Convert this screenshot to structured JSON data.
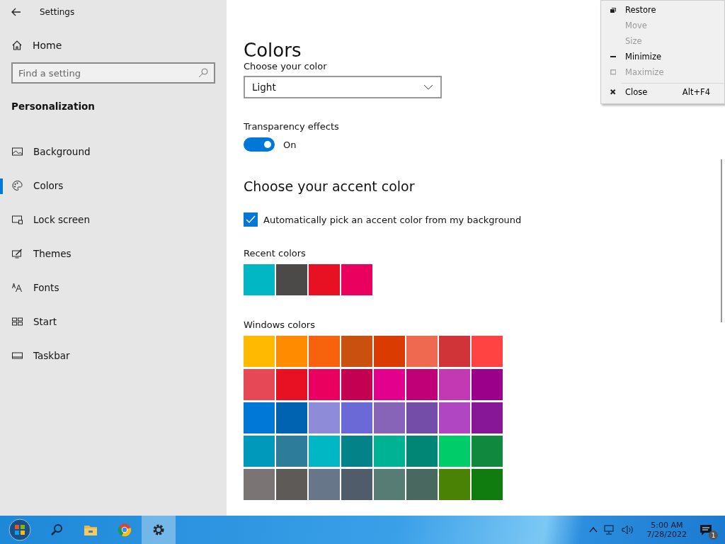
{
  "window": {
    "title": "Settings"
  },
  "sidebar": {
    "home": "Home",
    "search": {
      "placeholder": "Find a setting"
    },
    "section": "Personalization",
    "items": [
      {
        "label": "Background",
        "selected": false
      },
      {
        "label": "Colors",
        "selected": true
      },
      {
        "label": "Lock screen",
        "selected": false
      },
      {
        "label": "Themes",
        "selected": false
      },
      {
        "label": "Fonts",
        "selected": false
      },
      {
        "label": "Start",
        "selected": false
      },
      {
        "label": "Taskbar",
        "selected": false
      }
    ]
  },
  "page": {
    "title": "Colors",
    "color_mode": {
      "label": "Choose your color",
      "value": "Light"
    },
    "transparency": {
      "label": "Transparency effects",
      "on": true,
      "state_text": "On"
    },
    "accent": {
      "heading": "Choose your accent color",
      "auto": {
        "label": "Automatically pick an accent color from my background",
        "checked": true
      },
      "recent": {
        "label": "Recent colors",
        "swatches": [
          {
            "color": "#00b7c3"
          },
          {
            "color": "#4c4a48"
          },
          {
            "color": "#e81123"
          },
          {
            "color": "#ea005e"
          }
        ]
      },
      "windows": {
        "label": "Windows colors",
        "swatches": [
          {
            "color": "#ffb900"
          },
          {
            "color": "#ff8c00"
          },
          {
            "color": "#f7630c"
          },
          {
            "color": "#ca5010"
          },
          {
            "color": "#da3b01"
          },
          {
            "color": "#ef6950"
          },
          {
            "color": "#d13438"
          },
          {
            "color": "#ff4343"
          },
          {
            "color": "#e74856"
          },
          {
            "color": "#e81123"
          },
          {
            "color": "#ea005e"
          },
          {
            "color": "#c30052"
          },
          {
            "color": "#e3008c"
          },
          {
            "color": "#bf0077"
          },
          {
            "color": "#c239b3"
          },
          {
            "color": "#9a0089"
          },
          {
            "color": "#0078d7"
          },
          {
            "color": "#0063b1"
          },
          {
            "color": "#8e8cd8"
          },
          {
            "color": "#6b69d6"
          },
          {
            "color": "#8764b8"
          },
          {
            "color": "#744da9"
          },
          {
            "color": "#b146c2"
          },
          {
            "color": "#881798"
          },
          {
            "color": "#0099bc"
          },
          {
            "color": "#2d7d9a"
          },
          {
            "color": "#00b7c3"
          },
          {
            "color": "#038387"
          },
          {
            "color": "#00b294"
          },
          {
            "color": "#018574"
          },
          {
            "color": "#00cc6a"
          },
          {
            "color": "#10893e"
          },
          {
            "color": "#7a7574"
          },
          {
            "color": "#5d5a58"
          },
          {
            "color": "#68768a"
          },
          {
            "color": "#515c6b"
          },
          {
            "color": "#567c73"
          },
          {
            "color": "#486860"
          },
          {
            "color": "#498205"
          },
          {
            "color": "#107c10"
          }
        ]
      }
    }
  },
  "context_menu": {
    "items": [
      {
        "label": "Restore",
        "disabled": false
      },
      {
        "label": "Move",
        "disabled": true
      },
      {
        "label": "Size",
        "disabled": true
      },
      {
        "label": "Minimize",
        "disabled": false
      },
      {
        "label": "Maximize",
        "disabled": true
      },
      {
        "label": "Close",
        "disabled": false,
        "shortcut": "Alt+F4"
      }
    ]
  },
  "taskbar": {
    "apps": [
      {
        "selected": false
      },
      {
        "selected": false
      },
      {
        "selected": true
      }
    ],
    "clock": {
      "time": "5:00 AM",
      "date": "7/28/2022"
    },
    "notifications": {
      "count": "1"
    }
  }
}
